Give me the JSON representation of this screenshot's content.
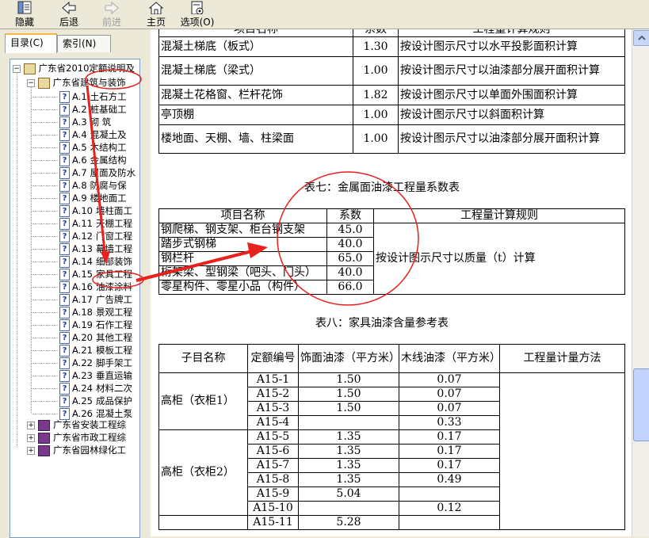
{
  "toolbar": {
    "buttons": [
      {
        "label": "隐藏",
        "icon": "hide-icon"
      },
      {
        "label": "后退",
        "icon": "back-arrow-icon"
      },
      {
        "label": "前进",
        "icon": "forward-arrow-icon",
        "disabled": true
      },
      {
        "label": "主页",
        "icon": "home-icon"
      },
      {
        "label": "选项(O)",
        "icon": "options-icon"
      }
    ]
  },
  "tabs": {
    "contents": "目录(C)",
    "index": "索引(N)"
  },
  "tree": {
    "root": "广东省2010定额说明及",
    "child": "广东省建筑与装饰",
    "items": [
      {
        "code": "A.1",
        "label": "土石方工"
      },
      {
        "code": "A.2",
        "label": "桩基础工"
      },
      {
        "code": "A.3",
        "label": "砌  筑"
      },
      {
        "code": "A.4",
        "label": "混凝土及"
      },
      {
        "code": "A.5",
        "label": "木结构工"
      },
      {
        "code": "A.6",
        "label": "金属结构"
      },
      {
        "code": "A.7",
        "label": "屋面及防水"
      },
      {
        "code": "A.8",
        "label": "防腐与保"
      },
      {
        "code": "A.9",
        "label": "楼地面工"
      },
      {
        "code": "A.10",
        "label": "墙柱面工"
      },
      {
        "code": "A.11",
        "label": "天棚工程"
      },
      {
        "code": "A.12",
        "label": "门窗工程"
      },
      {
        "code": "A.13",
        "label": "幕墙工程"
      },
      {
        "code": "A.14",
        "label": "细部装饰"
      },
      {
        "code": "A.15",
        "label": "家具工程"
      },
      {
        "code": "A.16",
        "label": "油漆涂料"
      },
      {
        "code": "A.17",
        "label": "广告牌工"
      },
      {
        "code": "A.18",
        "label": "景观工程"
      },
      {
        "code": "A.19",
        "label": "石作工程"
      },
      {
        "code": "A.20",
        "label": "其他工程"
      },
      {
        "code": "A.21",
        "label": "模板工程"
      },
      {
        "code": "A.22",
        "label": "脚手架工"
      },
      {
        "code": "A.23",
        "label": "垂直运输"
      },
      {
        "code": "A.24",
        "label": "材料二次"
      },
      {
        "code": "A.25",
        "label": "成品保护"
      },
      {
        "code": "A.26",
        "label": "混凝土泵"
      }
    ],
    "books": [
      "广东省安装工程综",
      "广东省市政工程综",
      "广东省园林绿化工"
    ]
  },
  "table6": {
    "headers": [
      "项目名称",
      "系数",
      "工程量计算规则"
    ],
    "rows": [
      [
        "混凝土梯底（板式）",
        "1.30",
        "按设计图示尺寸以水平投影面积计算"
      ],
      [
        "混凝土梯底（梁式）",
        "1.00",
        "按设计图示尺寸以油漆部分展开面积计算"
      ],
      [
        "混凝土花格窗、栏杆花饰",
        "1.82",
        "按设计图示尺寸以单面外围面积计算"
      ],
      [
        "亭顶棚",
        "1.00",
        "按设计图示尺寸以斜面积计算"
      ],
      [
        "楼地面、天棚、墙、柱梁面",
        "1.00",
        "按设计图示尺寸以油漆部分展开面积计算"
      ]
    ]
  },
  "table7": {
    "caption": "表七：金属面油漆工程量系数表",
    "headers": [
      "项目名称",
      "系数",
      "工程量计算规则"
    ],
    "rule": "按设计图示尺寸以质量（t）计算",
    "rows": [
      [
        "钢爬梯、钢支架、柜台钢支架",
        "45.0"
      ],
      [
        "踏步式钢梯",
        "40.0"
      ],
      [
        "钢栏杆",
        "65.0"
      ],
      [
        "桁架梁、型钢梁（吧头、门头）",
        "40.0"
      ],
      [
        "零星构件、零星小品（构件）",
        "66.0"
      ]
    ]
  },
  "table8": {
    "caption": "表八：家具油漆含量参考表",
    "headers": [
      "子目名称",
      "定额编号",
      "饰面油漆（平方米）",
      "木线油漆（平方米）",
      "工程量计量方法"
    ],
    "groups": [
      {
        "name": "高柜（衣柜1）",
        "rows": [
          [
            "A15-1",
            "1.50",
            "0.07"
          ],
          [
            "A15-2",
            "1.50",
            "0.07"
          ],
          [
            "A15-3",
            "1.50",
            "0.07"
          ],
          [
            "A15-4",
            "",
            "0.33"
          ]
        ]
      },
      {
        "name": "高柜（衣柜2）",
        "rows": [
          [
            "A15-5",
            "1.35",
            "0.17"
          ],
          [
            "A15-6",
            "1.35",
            "0.17"
          ],
          [
            "A15-7",
            "1.35",
            "0.17"
          ],
          [
            "A15-8",
            "1.35",
            "0.49"
          ],
          [
            "A15-9",
            "5.04",
            ""
          ],
          [
            "A15-10",
            "",
            "0.12"
          ]
        ]
      },
      {
        "name": "",
        "rows": [
          [
            "A15-11",
            "5.28",
            ""
          ]
        ]
      }
    ]
  },
  "colors": {
    "annotation": "#e8211c",
    "background": "#ece9d8"
  }
}
